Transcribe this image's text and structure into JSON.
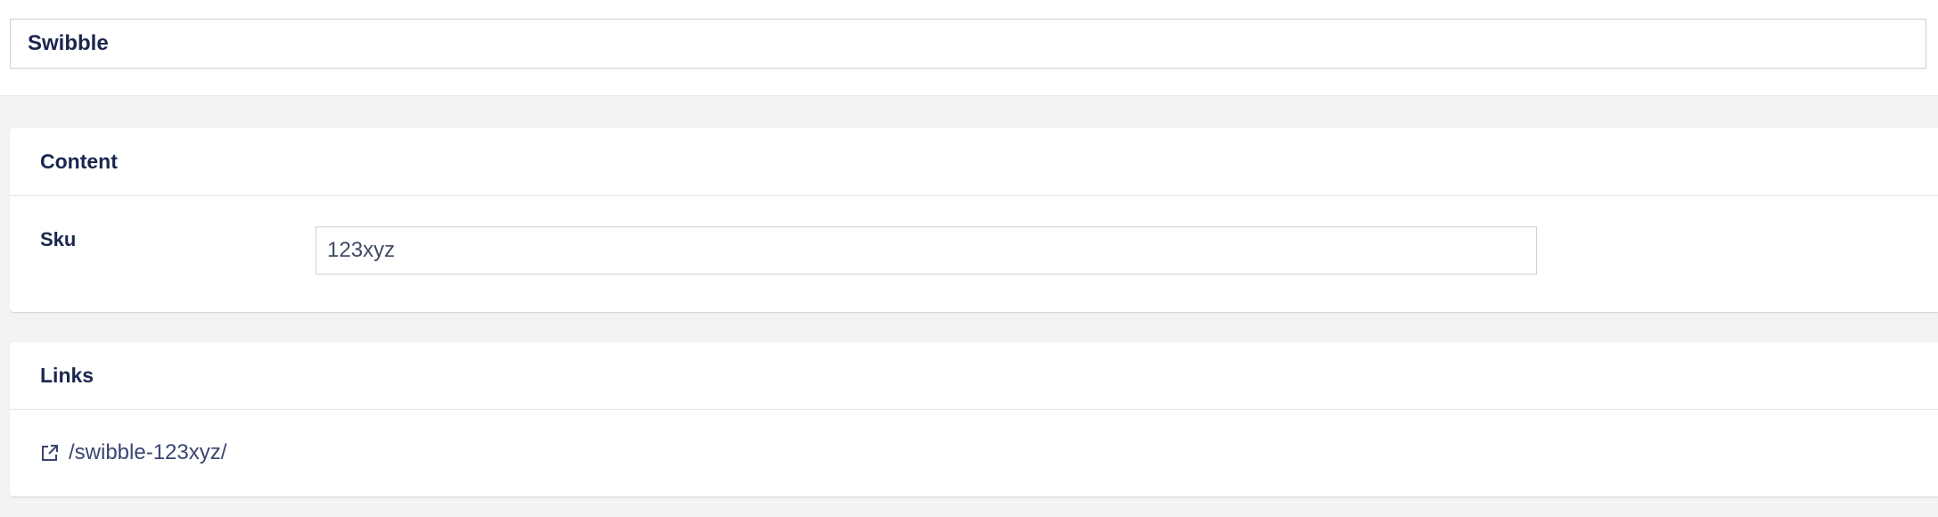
{
  "header": {
    "name_value": "Swibble"
  },
  "content_panel": {
    "title": "Content",
    "properties": [
      {
        "label": "Sku",
        "value": "123xyz"
      }
    ]
  },
  "links_panel": {
    "title": "Links",
    "links": [
      {
        "icon": "external-link-icon",
        "text": "/swibble-123xyz/"
      }
    ]
  },
  "colors": {
    "background": "#f3f3f3",
    "panel": "#ffffff",
    "text": "#1b264f",
    "link": "#3b4572",
    "border": "#d0d0d0"
  }
}
